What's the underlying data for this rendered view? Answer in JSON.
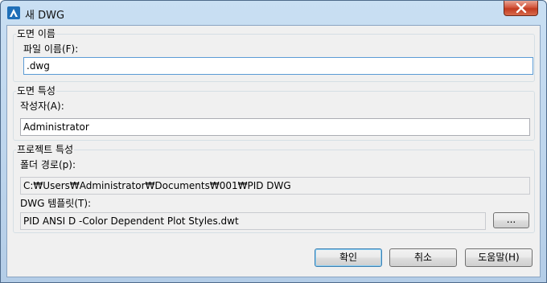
{
  "window": {
    "title": "새 DWG"
  },
  "section_drawing_name": {
    "label": "도면 이름",
    "file_name_label": "파일 이름(F):",
    "file_name_value": ".dwg"
  },
  "section_drawing_props": {
    "label": "도면 특성",
    "author_label": "작성자(A):",
    "author_value": "Administrator"
  },
  "section_project_props": {
    "label": "프로젝트 특성",
    "folder_label": "폴더 경로(p):",
    "folder_value": "C:₩Users₩Administrator₩Documents₩001₩PID DWG",
    "template_label": "DWG 템플릿(T):",
    "template_value": "PID ANSI D -Color Dependent Plot Styles.dwt",
    "browse_label": "..."
  },
  "buttons": {
    "ok": "확인",
    "cancel": "취소",
    "help": "도움말(H)"
  }
}
